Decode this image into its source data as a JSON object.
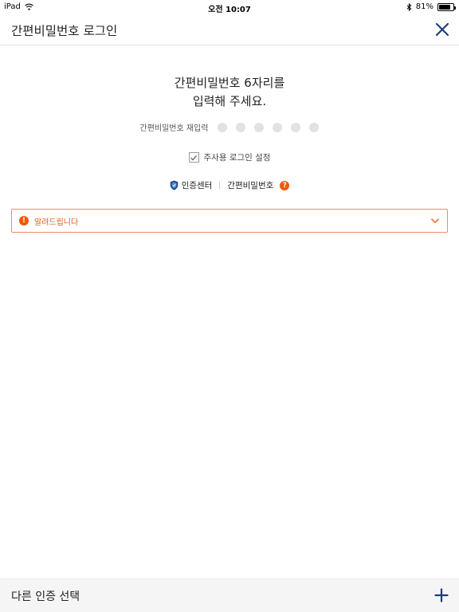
{
  "status_bar": {
    "device": "iPad",
    "time": "오전 10:07",
    "battery": "81%",
    "battery_level": 0.81
  },
  "header": {
    "title": "간편비밀번호 로그인",
    "close_icon": "close-icon"
  },
  "prompt": {
    "line1": "간편비밀번호 6자리를",
    "line2": "입력해 주세요."
  },
  "pin": {
    "label": "간편비밀번호 재입력",
    "length": 6,
    "filled": 0
  },
  "remember": {
    "label": "주사용 로그인 설정",
    "checked": true
  },
  "links": {
    "cert_center": "인증센터",
    "simple_password": "간편비밀번호",
    "help_mark": "?"
  },
  "notice": {
    "label": "알려드립니다",
    "mark": "!"
  },
  "footer": {
    "label": "다른 인증 선택"
  },
  "colors": {
    "accent": "#ee5a0d",
    "navy": "#1c3f7a",
    "dot_empty": "#e2e2e2",
    "notice_border": "#ef8a6a"
  }
}
